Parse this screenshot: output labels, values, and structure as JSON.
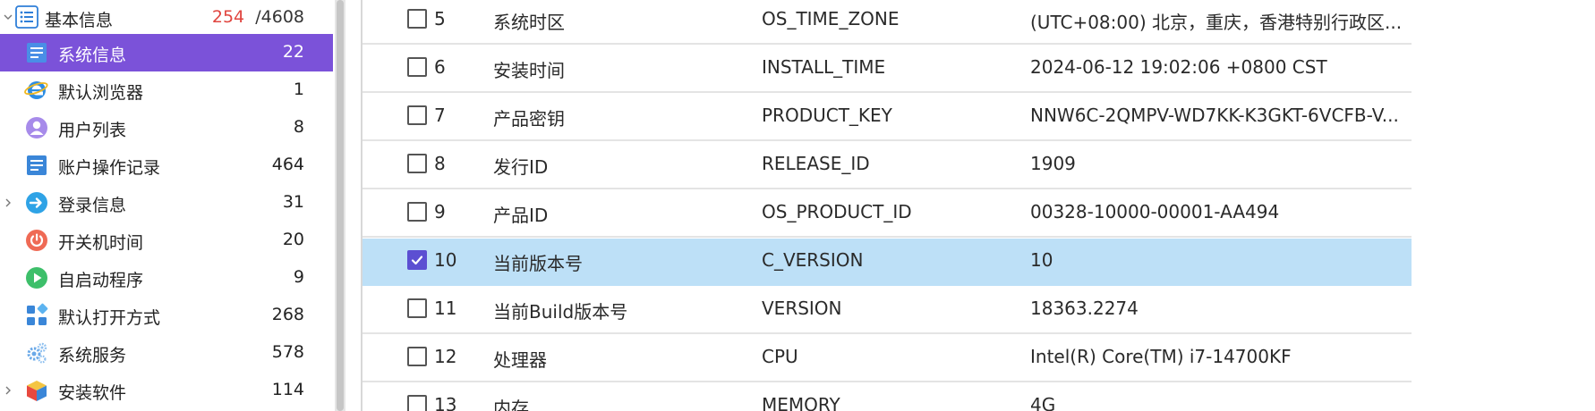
{
  "tree": {
    "root": {
      "label": "基本信息",
      "count_found": "254",
      "count_total": "/4608",
      "icon": "list-icon"
    },
    "items": [
      {
        "label": "系统信息",
        "count": "22",
        "icon": "system-info-icon",
        "selected": true,
        "expandable": false
      },
      {
        "label": "默认浏览器",
        "count": "1",
        "icon": "browser-icon",
        "selected": false,
        "expandable": false
      },
      {
        "label": "用户列表",
        "count": "8",
        "icon": "user-icon",
        "selected": false,
        "expandable": false
      },
      {
        "label": "账户操作记录",
        "count": "464",
        "icon": "account-log-icon",
        "selected": false,
        "expandable": false
      },
      {
        "label": "登录信息",
        "count": "31",
        "icon": "login-icon",
        "selected": false,
        "expandable": true
      },
      {
        "label": "开关机时间",
        "count": "20",
        "icon": "power-icon",
        "selected": false,
        "expandable": false
      },
      {
        "label": "自启动程序",
        "count": "9",
        "icon": "play-icon",
        "selected": false,
        "expandable": false
      },
      {
        "label": "默认打开方式",
        "count": "268",
        "icon": "apps-grid-icon",
        "selected": false,
        "expandable": false
      },
      {
        "label": "系统服务",
        "count": "578",
        "icon": "gears-icon",
        "selected": false,
        "expandable": false
      },
      {
        "label": "安装软件",
        "count": "114",
        "icon": "package-cube-icon",
        "selected": false,
        "expandable": true
      }
    ]
  },
  "table": {
    "rows": [
      {
        "no": "5",
        "name": "系统时区",
        "key": "OS_TIME_ZONE",
        "value": "(UTC+08:00) 北京，重庆，香港特别行政区...",
        "checked": false
      },
      {
        "no": "6",
        "name": "安装时间",
        "key": "INSTALL_TIME",
        "value": "2024-06-12 19:02:06 +0800 CST",
        "checked": false
      },
      {
        "no": "7",
        "name": "产品密钥",
        "key": "PRODUCT_KEY",
        "value": "NNW6C-2QMPV-WD7KK-K3GKT-6VCFB-V...",
        "checked": false
      },
      {
        "no": "8",
        "name": "发行ID",
        "key": "RELEASE_ID",
        "value": "1909",
        "checked": false
      },
      {
        "no": "9",
        "name": "产品ID",
        "key": "OS_PRODUCT_ID",
        "value": "00328-10000-00001-AA494",
        "checked": false
      },
      {
        "no": "10",
        "name": "当前版本号",
        "key": "C_VERSION",
        "value": "10",
        "checked": true
      },
      {
        "no": "11",
        "name": "当前Build版本号",
        "key": "VERSION",
        "value": "18363.2274",
        "checked": false
      },
      {
        "no": "12",
        "name": "处理器",
        "key": "CPU",
        "value": "Intel(R) Core(TM) i7-14700KF",
        "checked": false
      },
      {
        "no": "13",
        "name": "内存",
        "key": "MEMORY",
        "value": "4G",
        "checked": false
      }
    ]
  },
  "colors": {
    "tree_selected_bg": "#7b52d9",
    "row_selected_bg": "#bde0f7",
    "checkbox_checked": "#5c4fd2",
    "count_found": "#e0453f"
  }
}
